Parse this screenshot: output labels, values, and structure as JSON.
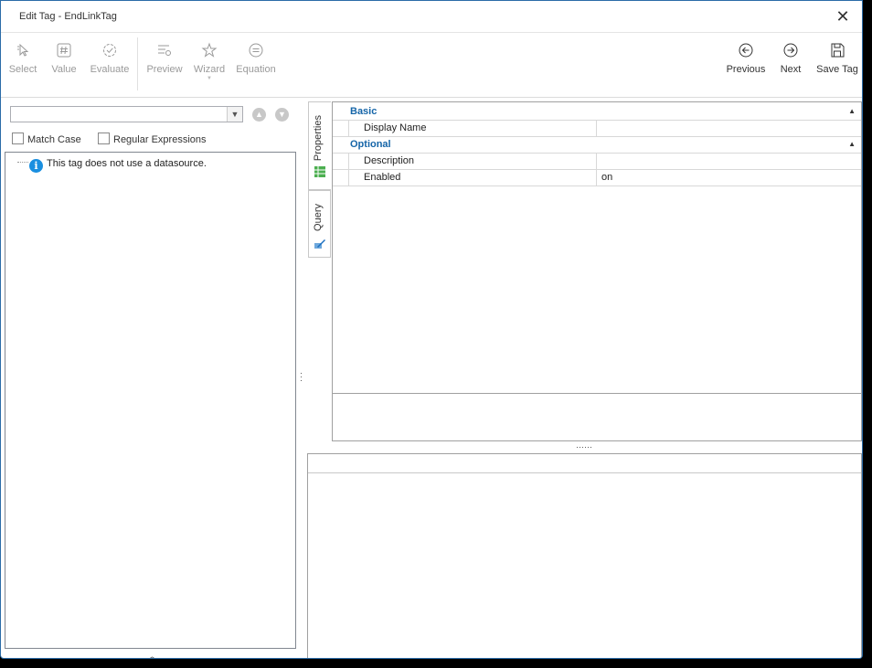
{
  "window": {
    "title": "Edit Tag - EndLinkTag",
    "close_glyph": "✕"
  },
  "toolbar": {
    "select_label": "Select",
    "value_label": "Value",
    "evaluate_label": "Evaluate",
    "preview_label": "Preview",
    "wizard_label": "Wizard",
    "equation_label": "Equation",
    "previous_label": "Previous",
    "next_label": "Next",
    "save_label": "Save Tag"
  },
  "search": {
    "value": "",
    "match_case_label": "Match Case",
    "regex_label": "Regular Expressions"
  },
  "tree": {
    "message": "This tag does not use a datasource."
  },
  "tabs": {
    "properties_label": "Properties",
    "query_label": "Query"
  },
  "properties": {
    "categories": [
      {
        "label": "Basic",
        "rows": [
          {
            "name": "Display Name",
            "value": ""
          }
        ]
      },
      {
        "label": "Optional",
        "rows": [
          {
            "name": "Description",
            "value": ""
          },
          {
            "name": "Enabled",
            "value": "on"
          }
        ]
      }
    ]
  },
  "colors": {
    "accent": "#1565a8",
    "info": "#1a8fe0",
    "border": "#2b6ca8"
  }
}
